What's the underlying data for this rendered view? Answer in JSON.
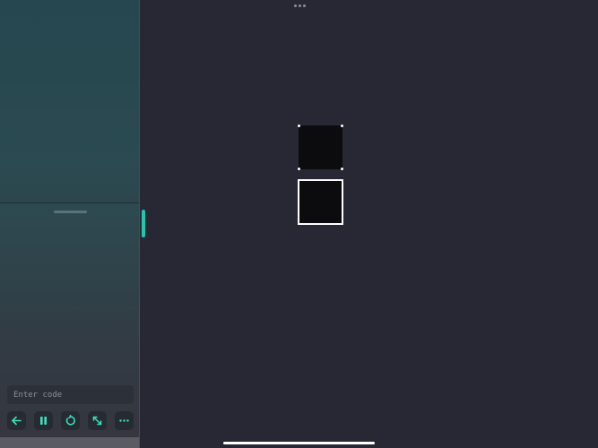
{
  "code_panel": {
    "code_input_placeholder": "Enter code",
    "code_input_value": ""
  },
  "toolbar": {
    "buttons": [
      {
        "name": "back",
        "icon": "arrow-left-icon"
      },
      {
        "name": "pause",
        "icon": "pause-icon"
      },
      {
        "name": "restart",
        "icon": "restart-icon"
      },
      {
        "name": "expand",
        "icon": "expand-icon"
      },
      {
        "name": "more",
        "icon": "more-icon"
      }
    ]
  },
  "colors": {
    "accent": "#3ee0c0",
    "canvas_background": "#272833",
    "node_fill": "#0c0c0e",
    "node_outline": "#ffffff"
  },
  "canvas": {
    "nodes": [
      {
        "name": "node-selected",
        "state": "selected"
      },
      {
        "name": "node-outlined",
        "state": "outlined"
      }
    ]
  }
}
